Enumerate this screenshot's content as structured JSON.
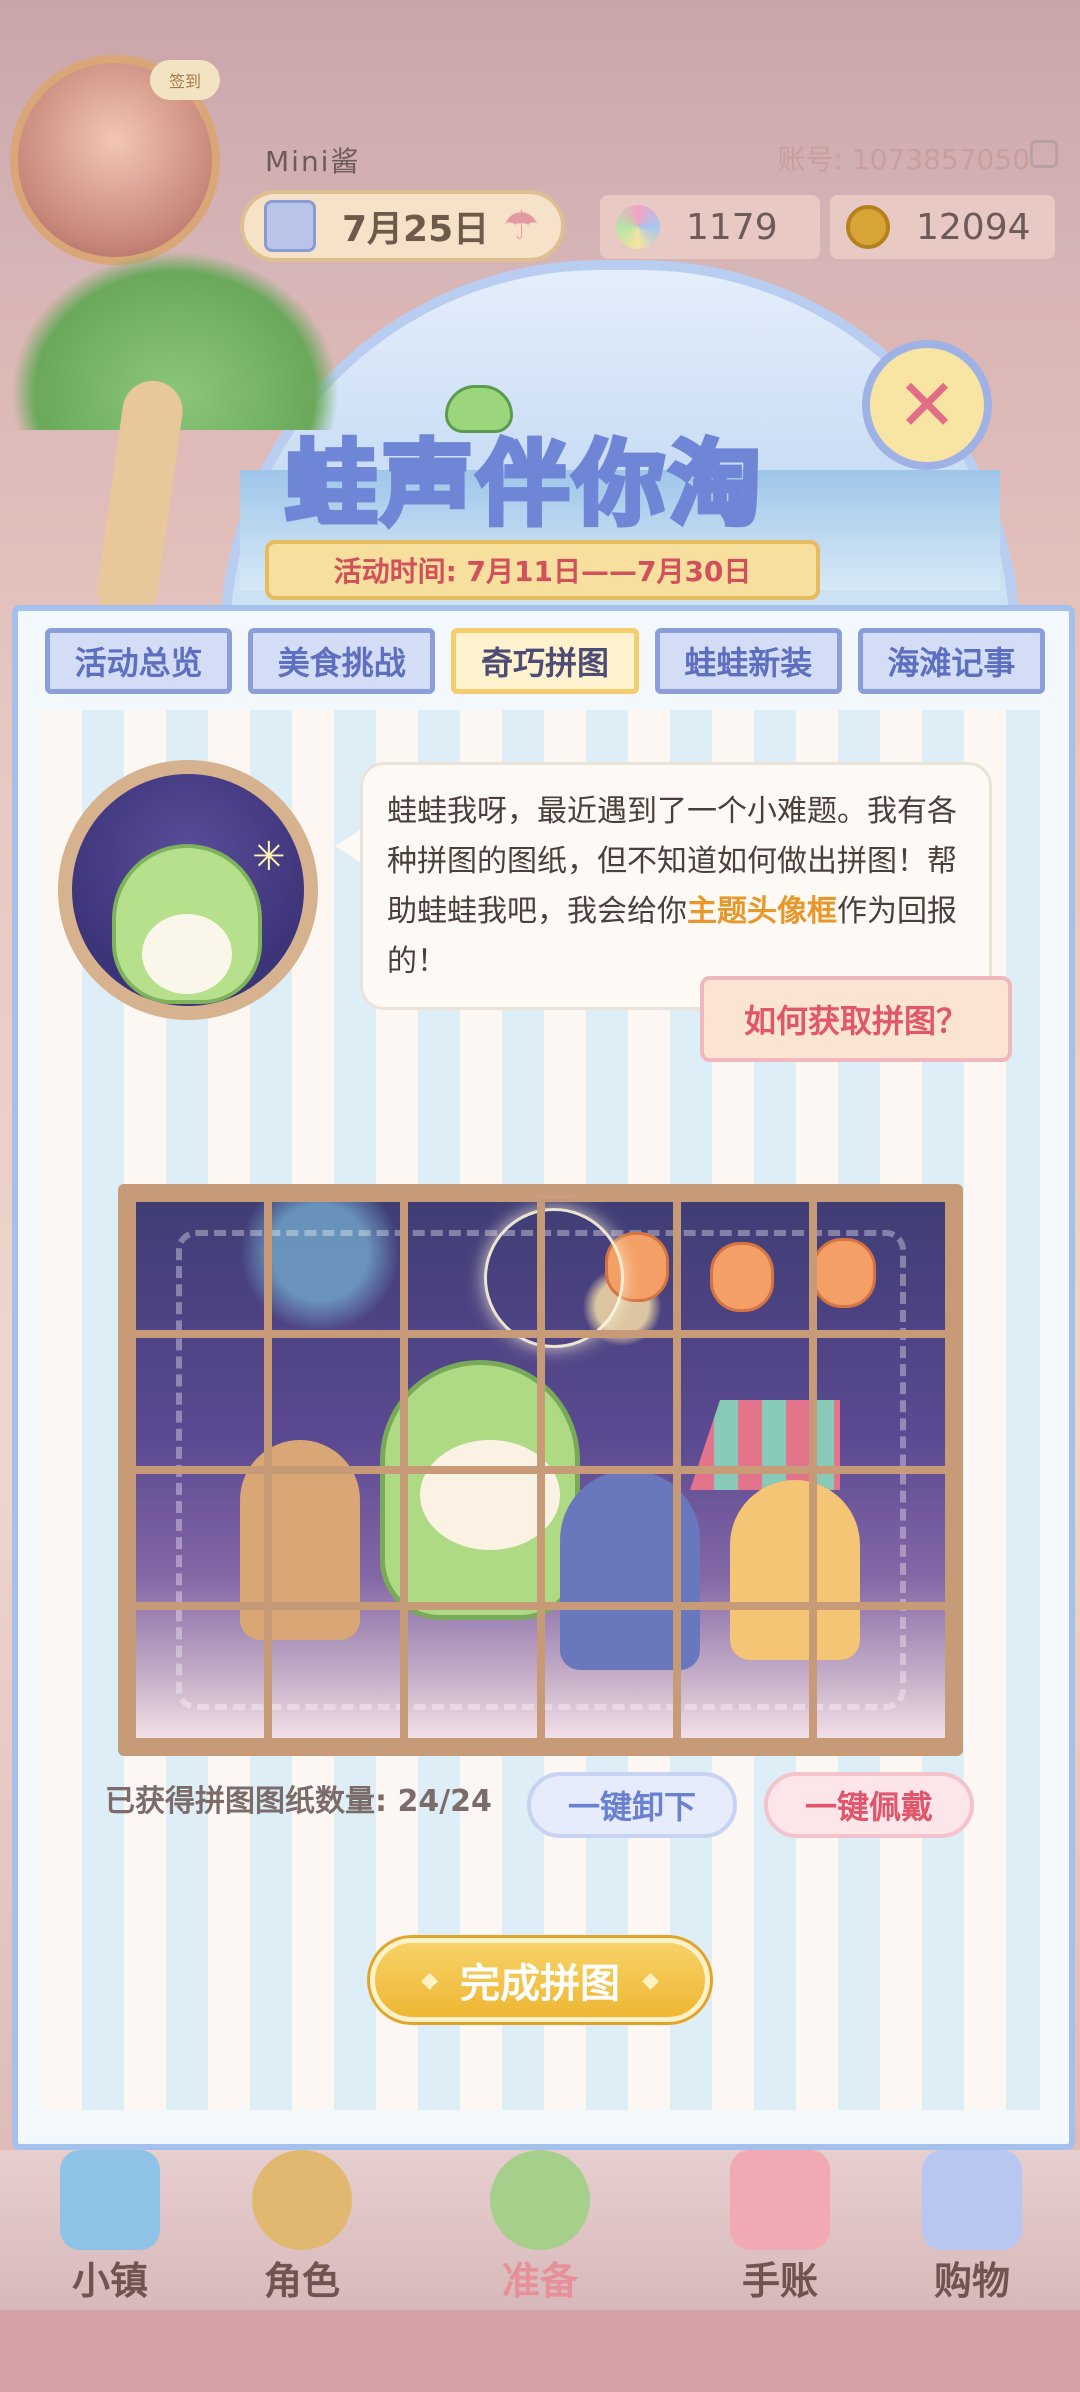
{
  "header": {
    "username": "Mini酱",
    "account": "账号: 1073857050",
    "date": "7月25日",
    "currency_gems": "1179",
    "currency_coins": "12094",
    "avatar_badge": "签到"
  },
  "event": {
    "title": "蛙声伴你淘",
    "time": "活动时间: 7月11日——7月30日"
  },
  "tabs": [
    {
      "label": "活动总览",
      "active": false
    },
    {
      "label": "美食挑战",
      "active": false
    },
    {
      "label": "奇巧拼图",
      "active": true
    },
    {
      "label": "蛙蛙新装",
      "active": false
    },
    {
      "label": "海滩记事",
      "active": false
    }
  ],
  "dialog": {
    "text_before": "蛙蛙我呀，最近遇到了一个小难题。我有各种拼图的图纸，但不知道如何做出拼图！帮助蛙蛙我吧，我会给你",
    "highlight": "主题头像框",
    "text_after": "作为回报的！",
    "how_button": "如何获取拼图？"
  },
  "puzzle": {
    "rows": 4,
    "cols": 6,
    "pieces_label": "已获得拼图图纸数量: 24/24",
    "pieces_obtained": 24,
    "pieces_total": 24,
    "unequip_button": "一键卸下",
    "equip_button": "一键佩戴",
    "finish_button": "完成拼图"
  },
  "nav": [
    {
      "label": "小镇",
      "icon": "map-icon"
    },
    {
      "label": "角色",
      "icon": "character-icon"
    },
    {
      "label": "准备",
      "icon": "prepare-icon"
    },
    {
      "label": "手账",
      "icon": "notebook-icon"
    },
    {
      "label": "购物",
      "icon": "shopping-bag-icon"
    }
  ],
  "colors": {
    "tab_border": "#8b9ed9",
    "tab_active_bg": "#fff3cf",
    "highlight": "#e8982a",
    "finish_button": "#efb733",
    "equip_text": "#e0566b",
    "unequip_text": "#6a80d0"
  }
}
